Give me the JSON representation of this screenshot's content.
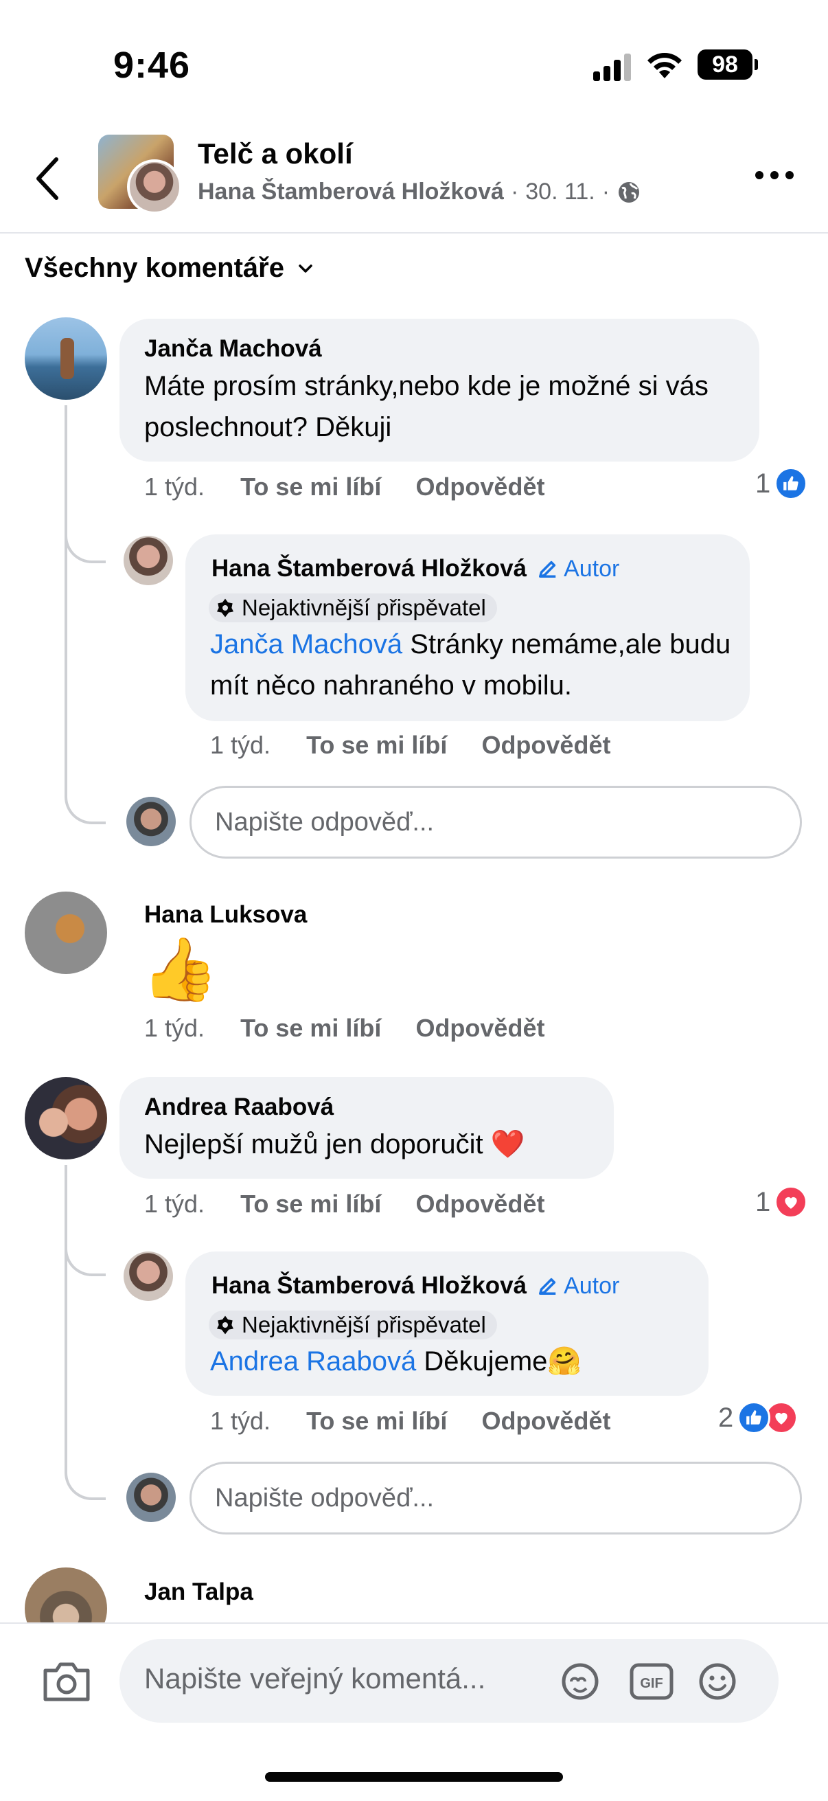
{
  "status": {
    "time": "9:46",
    "battery": "98"
  },
  "header": {
    "group_name": "Telč a okolí",
    "post_author": "Hana Štamberová Hložková",
    "separator": "·",
    "date": "30. 11.",
    "separator2": "·"
  },
  "filter": {
    "label": "Všechny komentáře"
  },
  "comments": [
    {
      "author": "Janča Machová",
      "text": "Máte prosím stránky,nebo kde je možné si vás poslechnout? Děkuji",
      "time": "1 týd.",
      "like_label": "To se mi líbí",
      "reply_label": "Odpovědět",
      "reaction_count": "1",
      "reply": {
        "author": "Hana Štamberová Hložková",
        "badge_author": "Autor",
        "badge_fan": "Nejaktivnější přispěvatel",
        "mention": "Janča Machová",
        "text": " Stránky nemáme,ale budu mít něco nahraného v mobilu.",
        "time": "1 týd.",
        "like_label": "To se mi líbí",
        "reply_label": "Odpovědět"
      },
      "reply_input_placeholder": "Napište odpověď..."
    },
    {
      "author": "Hana Luksova",
      "emoji": "👍",
      "time": "1 týd.",
      "like_label": "To se mi líbí",
      "reply_label": "Odpovědět"
    },
    {
      "author": "Andrea Raabová",
      "text": "Nejlepší mužů jen doporučit",
      "emoji": "❤️",
      "time": "1 týd.",
      "like_label": "To se mi líbí",
      "reply_label": "Odpovědět",
      "reaction_count": "1",
      "reply": {
        "author": "Hana Štamberová Hložková",
        "badge_author": "Autor",
        "badge_fan": "Nejaktivnější přispěvatel",
        "mention": "Andrea Raabová",
        "text": " Děkujeme",
        "emoji": "🤗",
        "time": "1 týd.",
        "like_label": "To se mi líbí",
        "reply_label": "Odpovědět",
        "reaction_count": "2"
      },
      "reply_input_placeholder": "Napište odpověď..."
    },
    {
      "author": "Jan Talpa"
    }
  ],
  "composer": {
    "placeholder": "Napište veřejný komentá..."
  },
  "colors": {
    "link": "#1b74e4",
    "like": "#1b74e4",
    "love": "#f33e58",
    "bubble": "#f0f2f5",
    "meta": "#65676b"
  }
}
